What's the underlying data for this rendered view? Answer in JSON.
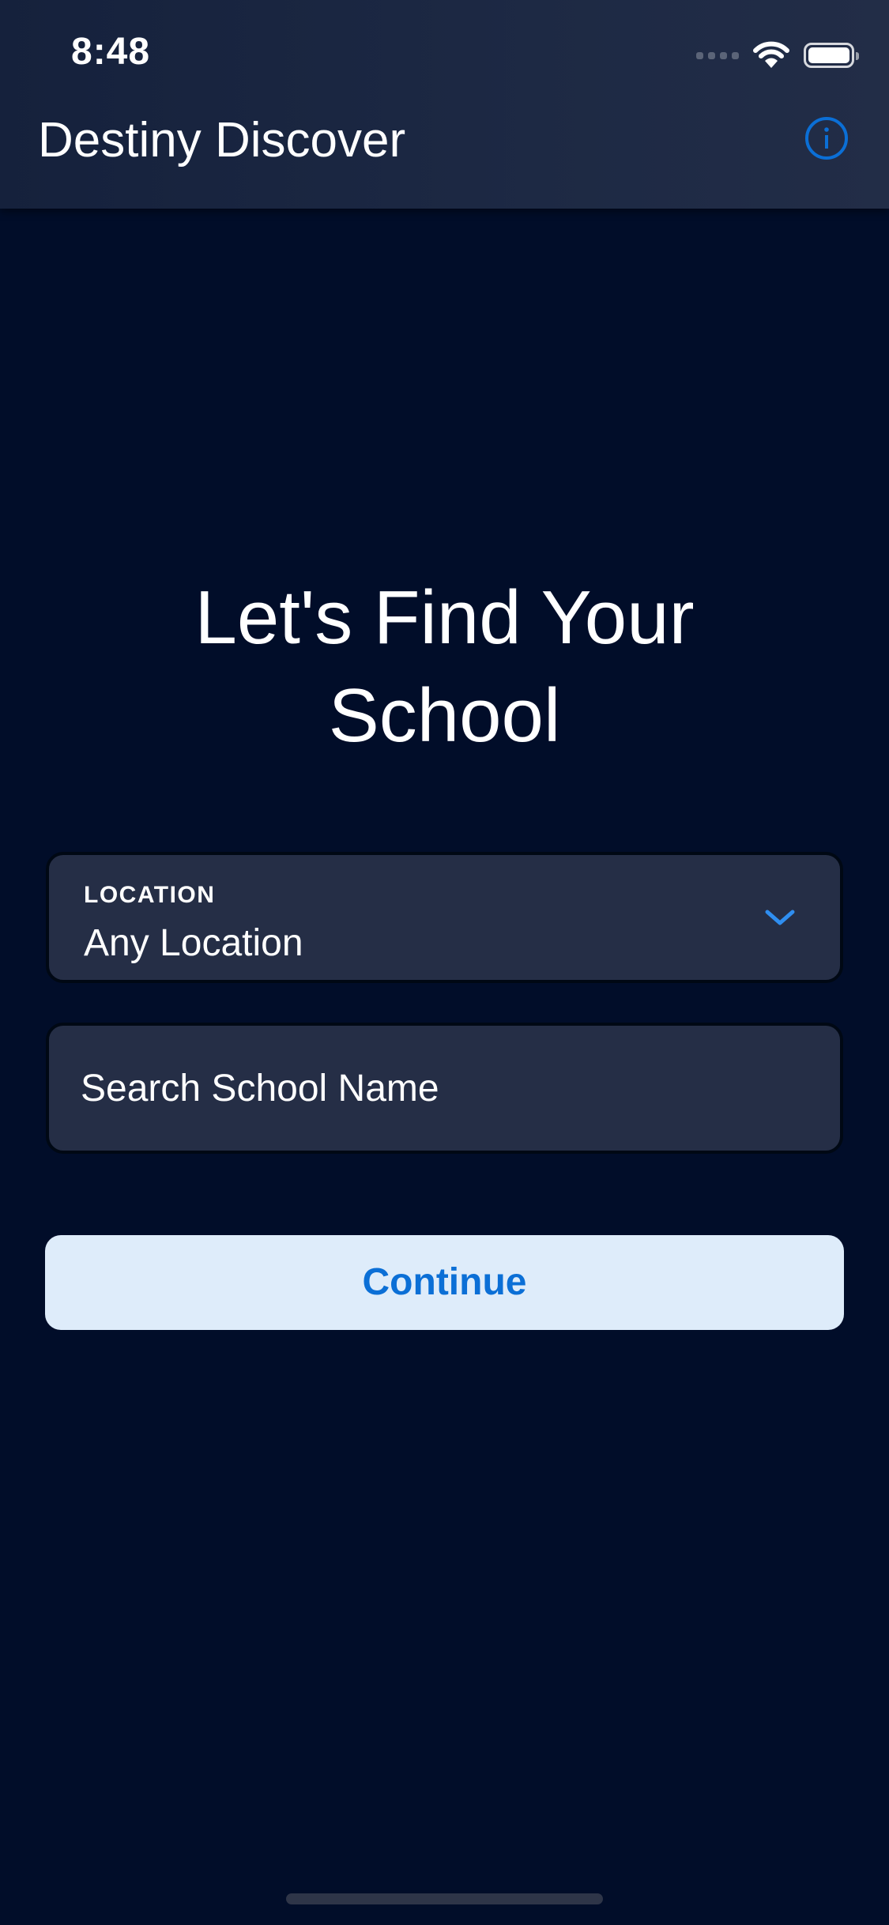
{
  "status_bar": {
    "time": "8:48",
    "icons": [
      "cellular-signal-icon",
      "wifi-icon",
      "battery-icon"
    ]
  },
  "nav_bar": {
    "title": "Destiny Discover",
    "info_icon": "info-icon"
  },
  "main": {
    "headline_line1": "Let's Find Your",
    "headline_line2": "School",
    "location": {
      "label": "LOCATION",
      "value": "Any Location",
      "icon": "chevron-down-icon"
    },
    "search": {
      "placeholder": "Search School Name",
      "value": ""
    },
    "continue_label": "Continue"
  },
  "colors": {
    "background": "#010d29",
    "header": "#1d2944",
    "field_background": "#252e46",
    "accent": "#0b6fd6",
    "button_background": "#deecfa"
  }
}
